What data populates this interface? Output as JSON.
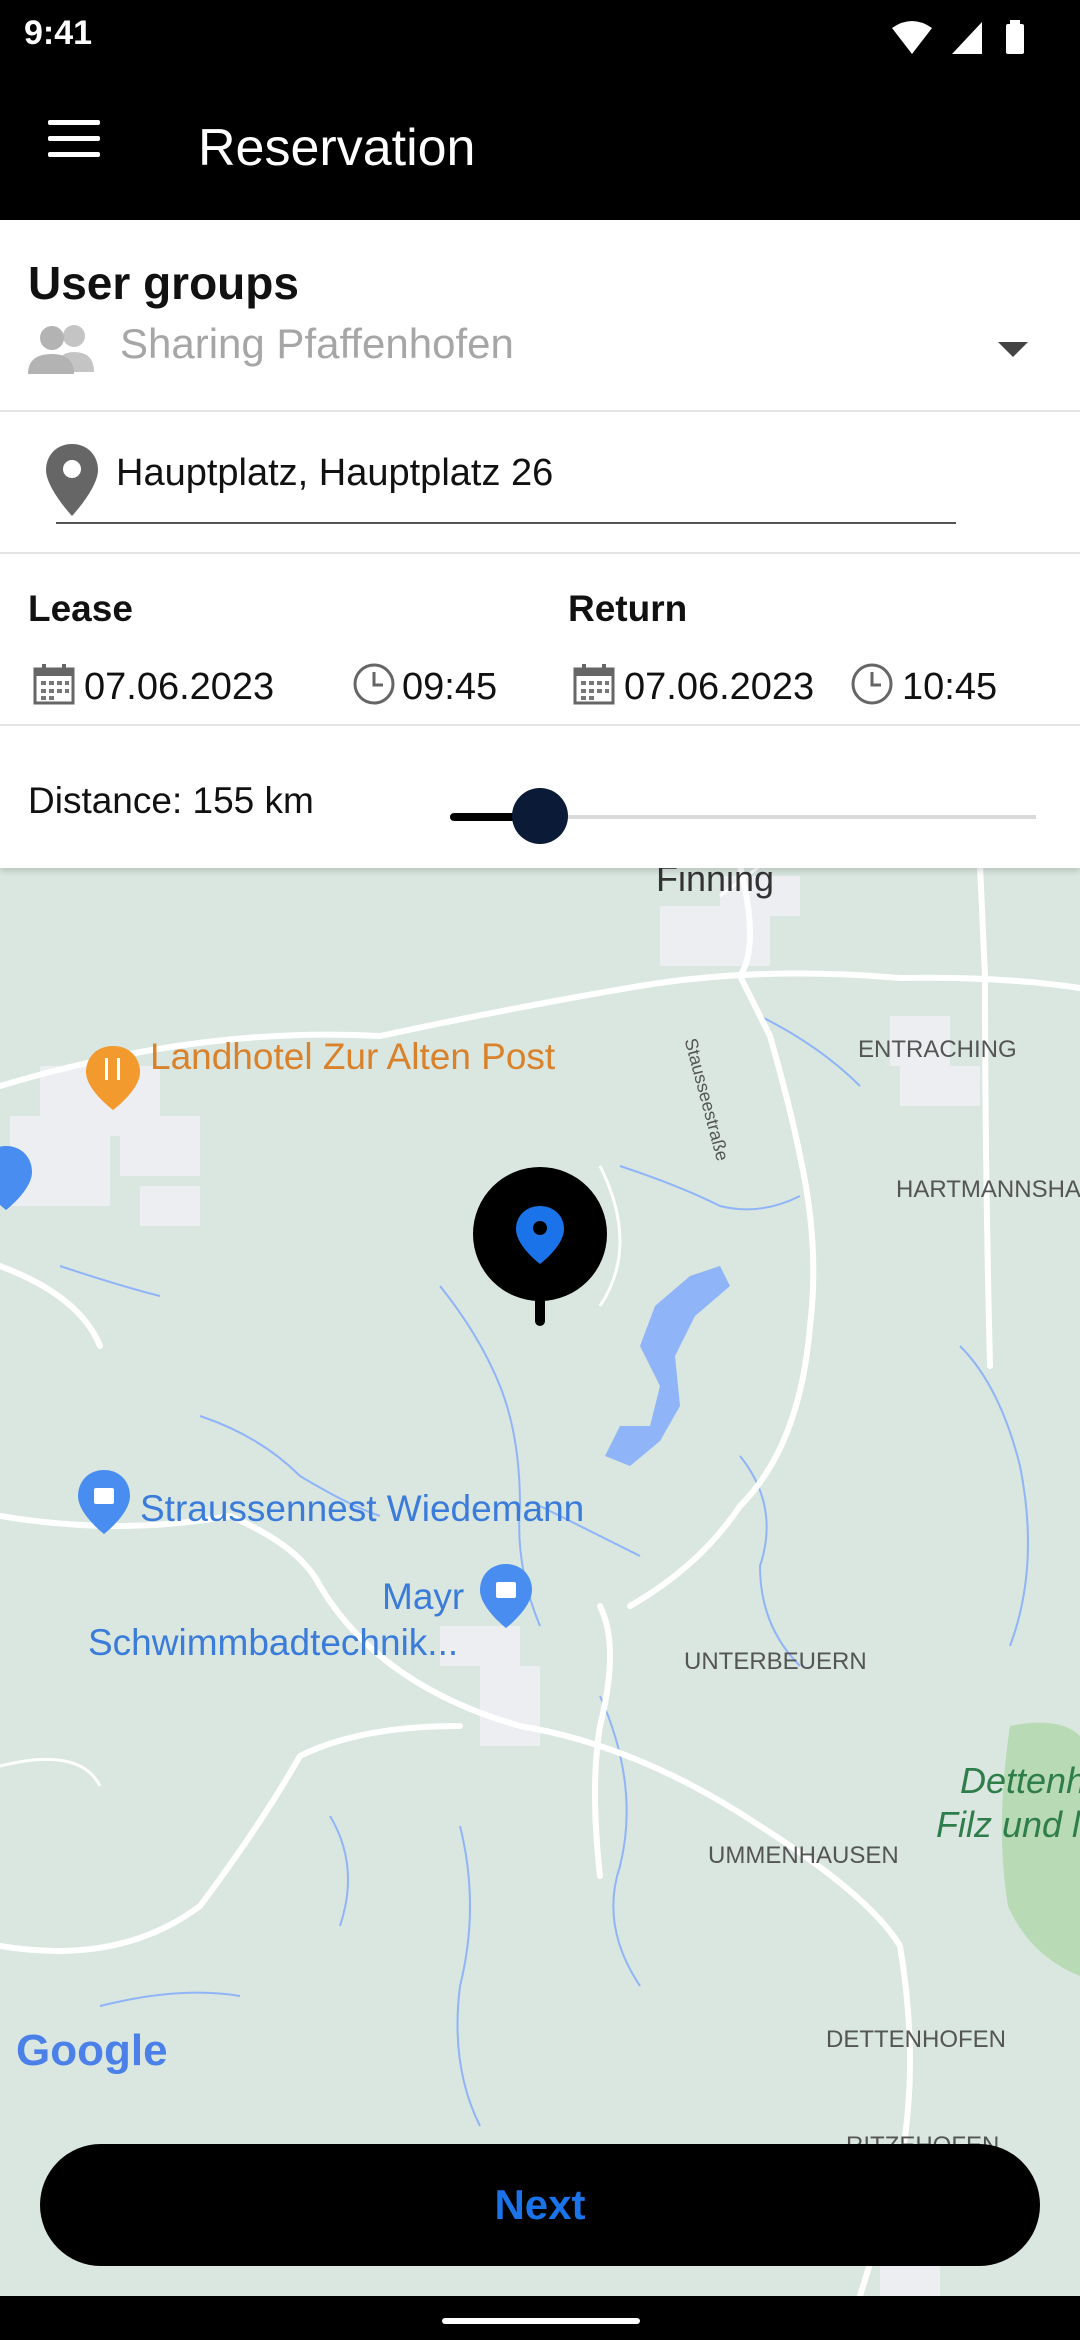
{
  "status_bar": {
    "time": "9:41"
  },
  "app_bar": {
    "title": "Reservation"
  },
  "user_groups": {
    "label": "User groups",
    "value": "Sharing Pfaffenhofen"
  },
  "location": {
    "value": "Hauptplatz, Hauptplatz 26"
  },
  "lease": {
    "label": "Lease",
    "date": "07.06.2023",
    "time": "09:45"
  },
  "return": {
    "label": "Return",
    "date": "07.06.2023",
    "time": "10:45"
  },
  "distance": {
    "label": "Distance: 155 km",
    "slider_level": 0.15
  },
  "map": {
    "places": {
      "finning": "Finning",
      "landhotel": "Landhotel Zur Alten Post",
      "street": "Stausseestraße",
      "entraching": "ENTRACHING",
      "hartmannshausen": "HARTMANNSHAU",
      "straussennest": "Straussennest Wiedemann",
      "mayr_line1": "Mayr",
      "mayr_line2": "Schwimmbadtechnik...",
      "unterbeuern": "UNTERBEUERN",
      "dettenh_line1": "Dettenh",
      "dettenh_line2": "Filz und l",
      "ummenhausen": "UMMENHAUSEN",
      "dettenhofen": "DETTENHOFEN",
      "ritzenhofen": "RITZEHOFEN"
    },
    "attribution": "Google"
  },
  "next_button": {
    "label": "Next"
  },
  "colors": {
    "accent": "#1a73e8",
    "slider_thumb": "#0b1a36",
    "map_bg": "#d9e7e0",
    "poi_orange": "#d9822b"
  }
}
